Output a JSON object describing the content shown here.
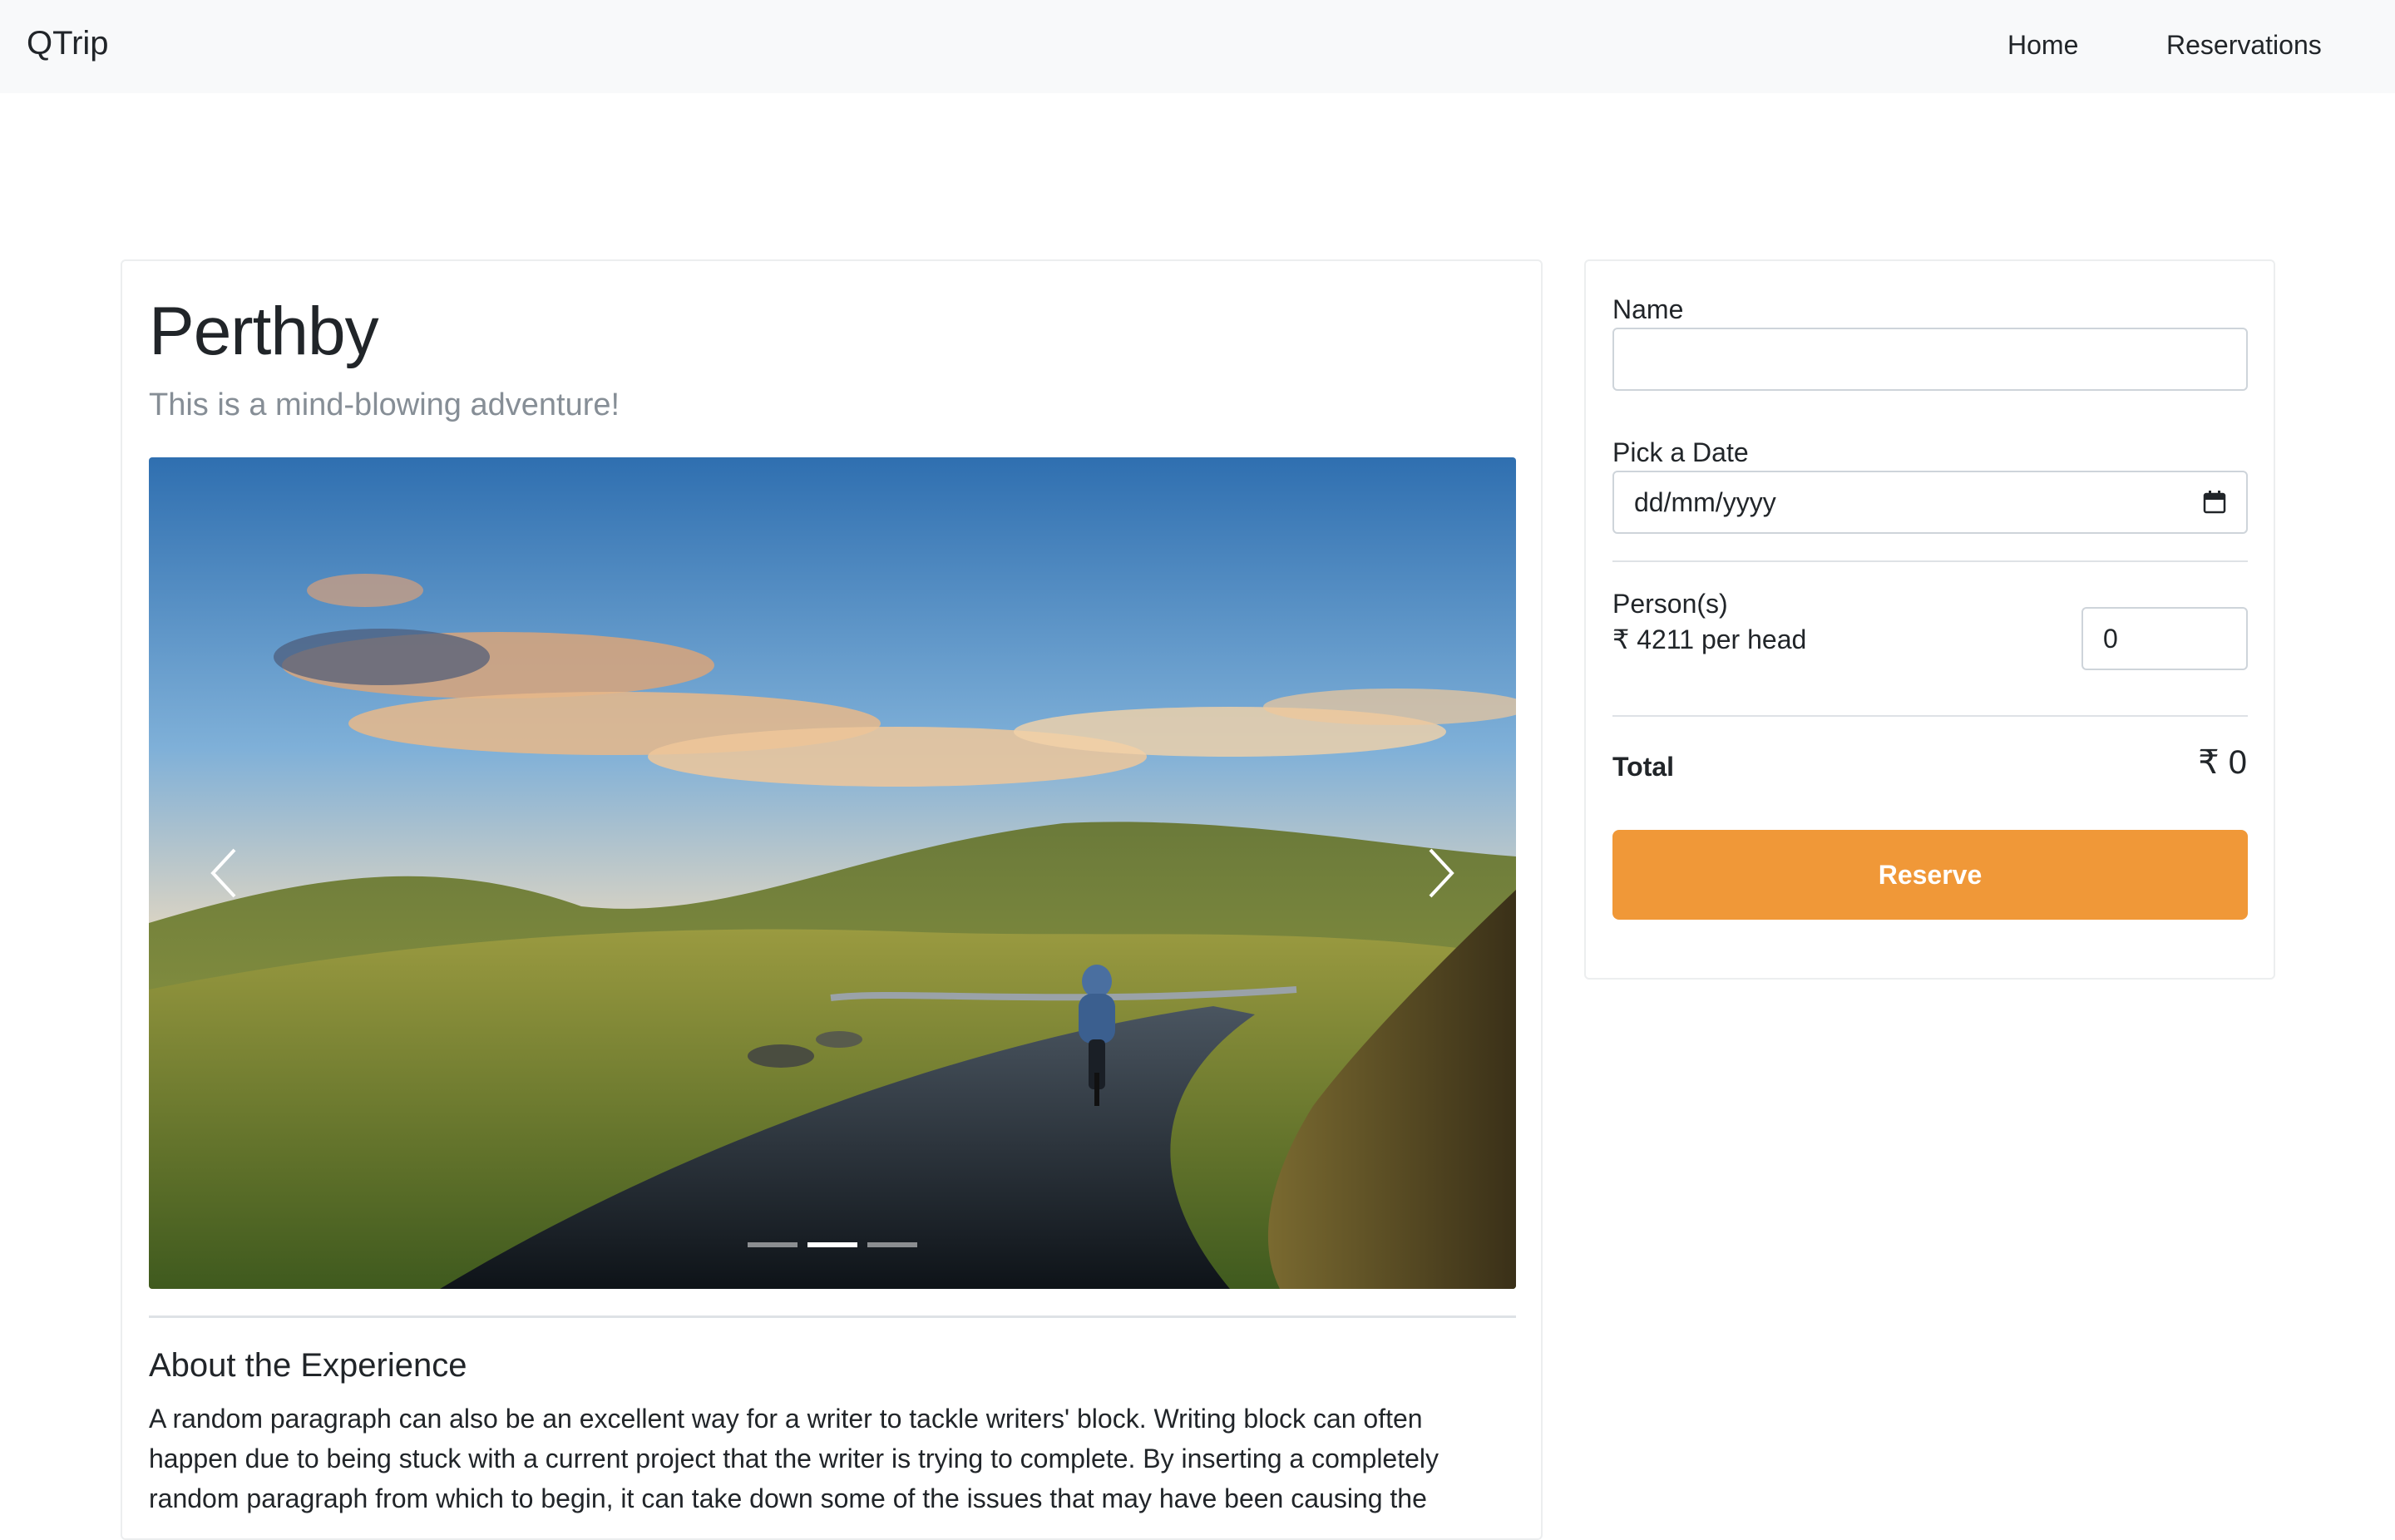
{
  "navbar": {
    "brand": "QTrip",
    "links": [
      "Home",
      "Reservations"
    ]
  },
  "adventure": {
    "title": "Perthby",
    "subtitle": "This is a mind-blowing adventure!",
    "carousel": {
      "active_index": 1,
      "slide_count": 3,
      "image_alt": "Cyclist riding on a winding road through green hills at sunset"
    },
    "about_title": "About the Experience",
    "about_text": "A random paragraph can also be an excellent way for a writer to tackle writers' block. Writing block can often happen due to being stuck with a current project that the writer is trying to complete. By inserting a completely random paragraph from which to begin, it can take down some of the issues that may have been causing the"
  },
  "reservation": {
    "name_label": "Name",
    "name_value": "",
    "date_label": "Pick a Date",
    "date_placeholder": "dd/mm/yyyy",
    "persons_label": "Person(s)",
    "per_head": "₹ 4211 per head",
    "persons_value": "0",
    "total_label": "Total",
    "total_value": "₹ 0",
    "reserve_label": "Reserve"
  },
  "colors": {
    "accent": "#f09838",
    "navbar_bg": "#f8f9fa"
  }
}
